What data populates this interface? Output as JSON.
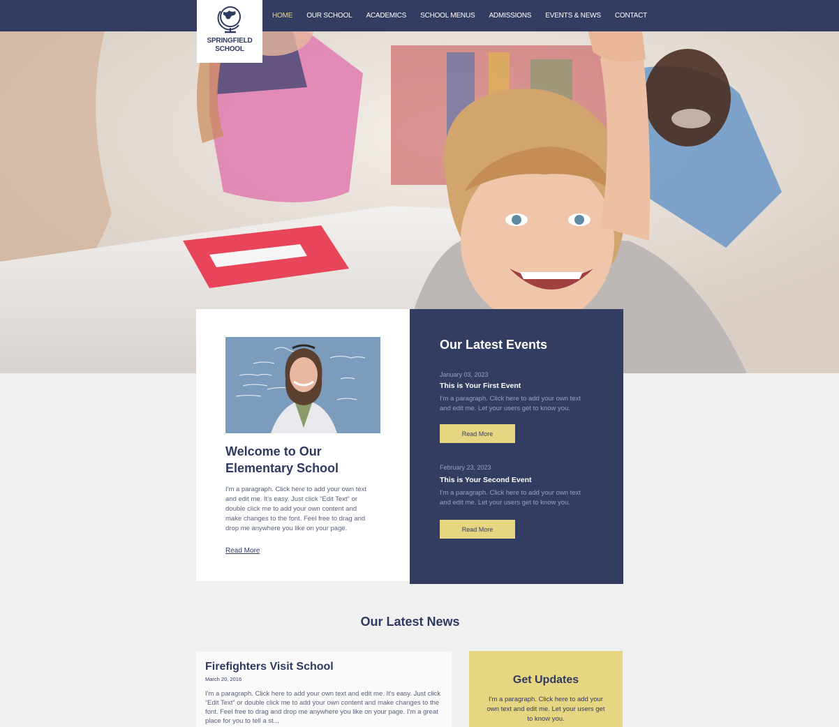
{
  "colors": {
    "navy": "#333d62",
    "accent": "#e7d681",
    "background": "#f0f0f0"
  },
  "logo": {
    "icon": "globe-icon",
    "line1": "SPRINGFIELD",
    "line2": "SCHOOL"
  },
  "nav": {
    "items": [
      {
        "label": "HOME",
        "active": true
      },
      {
        "label": "OUR SCHOOL"
      },
      {
        "label": "ACADEMICS"
      },
      {
        "label": "SCHOOL MENUS"
      },
      {
        "label": "ADMISSIONS"
      },
      {
        "label": "EVENTS & NEWS"
      },
      {
        "label": "CONTACT"
      }
    ]
  },
  "welcome": {
    "title": "Welcome to Our Elementary School",
    "body": "I'm a paragraph. Click here to add your own text and edit me. It's easy. Just click “Edit Text” or double click me to add your own content and make changes to the font. Feel free to drag and drop me anywhere you like on your page.",
    "link": "Read More"
  },
  "events": {
    "title": "Our Latest Events",
    "items": [
      {
        "date": "January 03, 2023",
        "title": "This is Your First Event",
        "desc": "I'm a paragraph. Click here to add your own text and edit me. Let your users get to know you.",
        "button": "Read More"
      },
      {
        "date": "February 23, 2023",
        "title": "This is Your Second Event",
        "desc": "I'm a paragraph. Click here to add your own text and edit me. Let your users get to know you.",
        "button": "Read More"
      }
    ]
  },
  "news": {
    "section_title": "Our Latest News",
    "post": {
      "title": "Firefighters Visit School",
      "date": "March 20, 2016",
      "excerpt": "I'm a paragraph. Click here to add your own text and edit me. It's easy. Just click “Edit Text” or double click me to add your own content and make changes to the font. Feel free to drag and drop me anywhere you like on your page. I’m a great place for you to tell a st..."
    }
  },
  "updates": {
    "title": "Get Updates",
    "body": "I'm a paragraph. Click here to add your own text and edit me. Let your users get to know you."
  }
}
